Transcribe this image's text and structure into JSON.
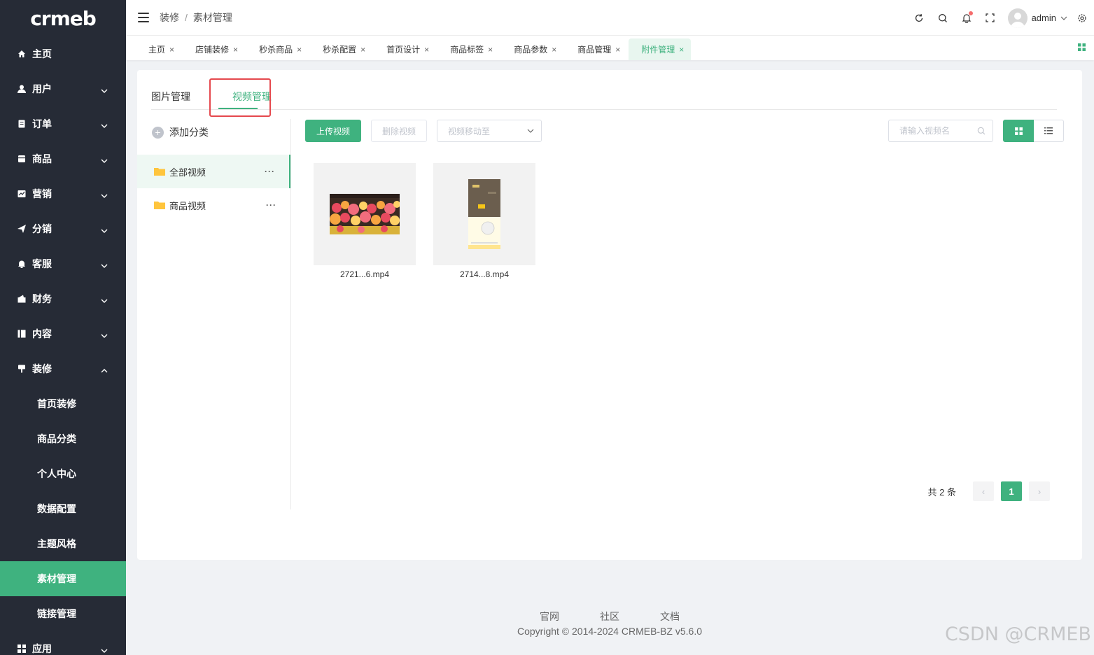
{
  "logo": "crmeb",
  "sidebar": {
    "home": "主页",
    "menus": [
      {
        "label": "用户",
        "icon": "user-icon"
      },
      {
        "label": "订单",
        "icon": "order-icon"
      },
      {
        "label": "商品",
        "icon": "product-icon"
      },
      {
        "label": "营销",
        "icon": "marketing-icon"
      },
      {
        "label": "分销",
        "icon": "distribution-icon"
      },
      {
        "label": "客服",
        "icon": "service-icon"
      },
      {
        "label": "财务",
        "icon": "finance-icon"
      },
      {
        "label": "内容",
        "icon": "content-icon"
      },
      {
        "label": "装修",
        "icon": "decoration-icon"
      }
    ],
    "submenu": [
      "首页装修",
      "商品分类",
      "个人中心",
      "数据配置",
      "主题风格",
      "素材管理",
      "链接管理"
    ],
    "active_sub": "素材管理",
    "last_menu": "应用"
  },
  "header": {
    "breadcrumb": [
      "装修",
      "素材管理"
    ],
    "separator": "/",
    "user": "admin"
  },
  "tabs": [
    {
      "label": "主页"
    },
    {
      "label": "店铺装修"
    },
    {
      "label": "秒杀商品"
    },
    {
      "label": "秒杀配置"
    },
    {
      "label": "首页设计"
    },
    {
      "label": "商品标签"
    },
    {
      "label": "商品参数"
    },
    {
      "label": "商品管理"
    },
    {
      "label": "附件管理",
      "active": true
    }
  ],
  "tab_close": "×",
  "content_tabs": {
    "images": "图片管理",
    "videos": "视频管理"
  },
  "categories": {
    "add_label": "添加分类",
    "add_icon": "+",
    "items": [
      {
        "label": "全部视频",
        "more": "···"
      },
      {
        "label": "商品视频",
        "more": "···"
      }
    ]
  },
  "toolbar": {
    "upload": "上传视频",
    "delete": "删除视频",
    "move_placeholder": "视频移动至",
    "search_placeholder": "请输入视频名"
  },
  "files": [
    {
      "name": "2721...6.mp4"
    },
    {
      "name": "2714...8.mp4"
    }
  ],
  "pagination": {
    "total": "共 2 条",
    "prev": "‹",
    "current": "1",
    "next": "›"
  },
  "footer": {
    "links": [
      "官网",
      "社区",
      "文档"
    ],
    "copyright": "Copyright © 2014-2024 CRMEB-BZ v5.6.0"
  },
  "watermark": "CSDN @CRMEB",
  "colors": {
    "accent": "#3fb27f",
    "sidebar_bg": "#262b36",
    "highlight": "#e5484d"
  }
}
